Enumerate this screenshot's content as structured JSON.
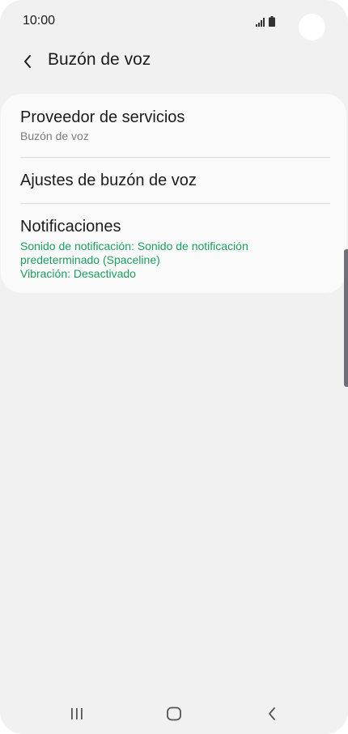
{
  "status_bar": {
    "time": "10:00",
    "icons": [
      "signal-icon",
      "battery-icon"
    ]
  },
  "header": {
    "title": "Buzón de voz",
    "back_icon": "chevron-left-icon"
  },
  "settings": {
    "items": [
      {
        "title": "Proveedor de servicios",
        "subtitle": "Buzón de voz"
      },
      {
        "title": "Ajustes de buzón de voz"
      },
      {
        "title": "Notificaciones",
        "details": [
          "Sonido de notificación: Sonido de notificación",
          "predeterminado (Spaceline)",
          "Vibración: Desactivado"
        ]
      }
    ]
  },
  "nav_bar": {
    "icons": [
      "recent-apps-icon",
      "home-icon",
      "back-icon"
    ]
  },
  "colors": {
    "background": "#f1f1f1",
    "card": "#fafafa",
    "accent_green": "#1a9e5c",
    "subtitle_gray": "#7b7b7b"
  }
}
